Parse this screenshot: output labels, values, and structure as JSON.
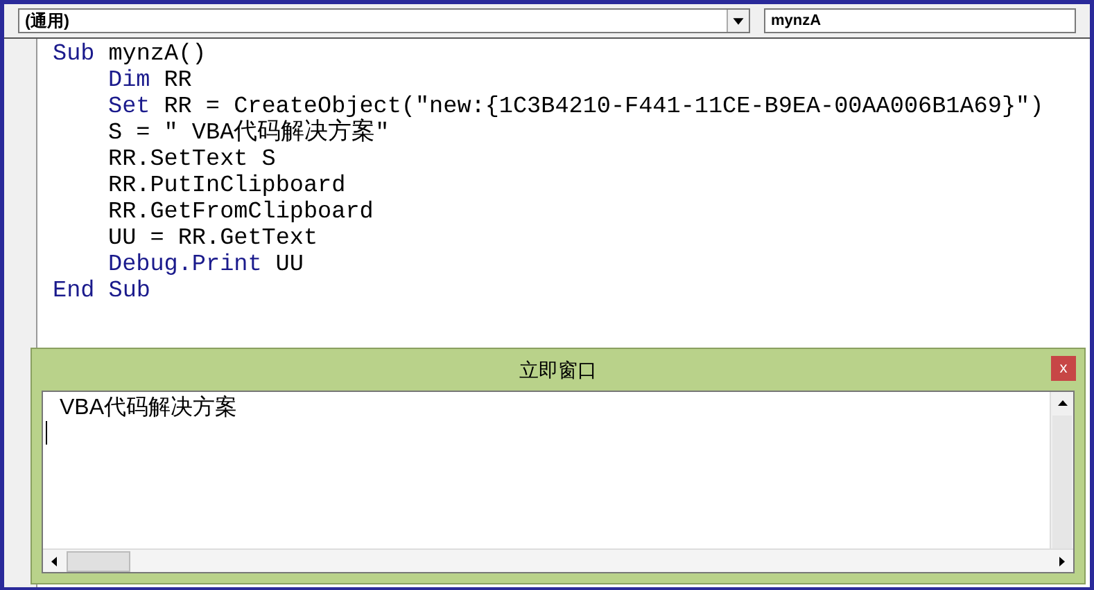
{
  "object_dropdown": {
    "value": "(通用)"
  },
  "procedure_dropdown": {
    "value": "mynzA"
  },
  "code": {
    "header": [
      {
        "text": "Sub",
        "kind": "keyword"
      },
      {
        "text": "mynzA()",
        "kind": "plain"
      }
    ],
    "body": [
      [
        {
          "text": "Dim",
          "kind": "keyword"
        },
        {
          "text": "RR",
          "kind": "plain"
        }
      ],
      [
        {
          "text": "Set",
          "kind": "keyword"
        },
        {
          "text": "RR = CreateObject(\"new:{1C3B4210-F441-11CE-B9EA-00AA006B1A69}\")",
          "kind": "plain"
        }
      ],
      [
        {
          "text": "S = \" VBA代码解决方案\"",
          "kind": "plain"
        }
      ],
      [
        {
          "text": "RR.SetText S",
          "kind": "plain"
        }
      ],
      [
        {
          "text": "RR.PutInClipboard",
          "kind": "plain"
        }
      ],
      [
        {
          "text": "RR.GetFromClipboard",
          "kind": "plain"
        }
      ],
      [
        {
          "text": "UU = RR.GetText",
          "kind": "plain"
        }
      ],
      [
        {
          "text": "Debug.Print",
          "kind": "keyword"
        },
        {
          "text": "UU",
          "kind": "plain"
        }
      ]
    ],
    "footer": [
      {
        "text": "End Sub",
        "kind": "keyword"
      }
    ]
  },
  "immediate_window": {
    "title": "立即窗口",
    "close": "x",
    "output": [
      "VBA代码解决方案"
    ]
  }
}
